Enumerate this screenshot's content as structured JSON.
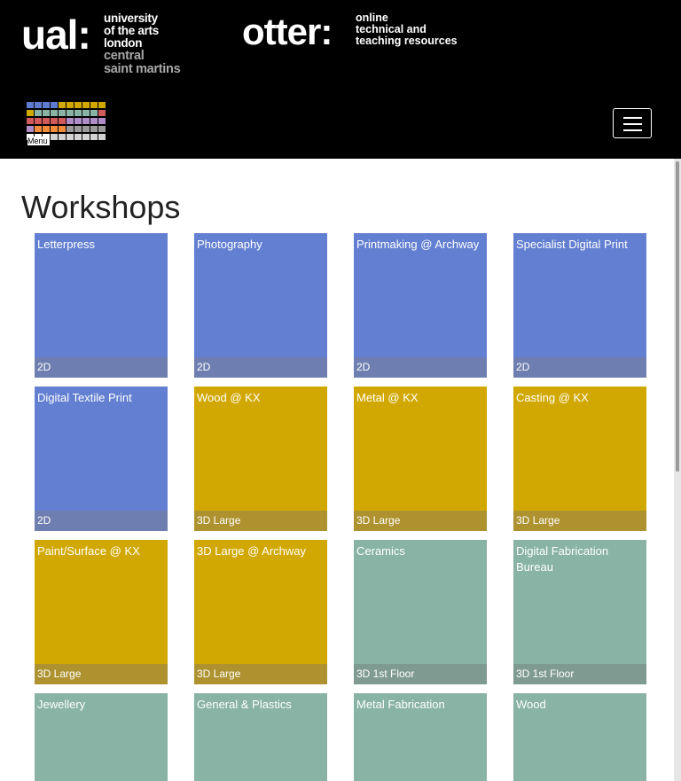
{
  "header": {
    "ual": {
      "mark": "ual:",
      "lines_white": [
        "university",
        "of the arts",
        "london"
      ],
      "lines_grey": [
        "central",
        "saint martins"
      ]
    },
    "otter": {
      "wordmark": "otter:",
      "tagline": [
        "online",
        "technical and",
        "teaching resources"
      ]
    },
    "menu_label": "Menu",
    "menu_icon_name": "hamburger-menu-icon",
    "menu_grid_colors": [
      [
        "#5f7bd0",
        "#5f7bd0",
        "#5f7bd0",
        "#5f7bd0",
        "#d1a800",
        "#d1a800",
        "#d1a800",
        "#d1a800",
        "#d1a800",
        "#d1a800"
      ],
      [
        "#d1a800",
        "#88b3a5",
        "#88b3a5",
        "#88b3a5",
        "#88b3a5",
        "#88b3a5",
        "#88b3a5",
        "#88b3a5",
        "#88b3a5",
        "#d25a5a"
      ],
      [
        "#d25a5a",
        "#d25a5a",
        "#d25a5a",
        "#d25a5a",
        "#d25a5a",
        "#b08cc8",
        "#b08cc8",
        "#b08cc8",
        "#b08cc8",
        "#b08cc8"
      ],
      [
        "#b08cc8",
        "#f08a3c",
        "#f08a3c",
        "#f08a3c",
        "#f08a3c",
        "#9a9a9a",
        "#9a9a9a",
        "#9a9a9a",
        "#9a9a9a",
        "#9a9a9a"
      ],
      [
        "#ffffff",
        "#ffffff",
        "#ffffff",
        "#d3d3d3",
        "#d3d3d3",
        "#d3d3d3",
        "#d3d3d3",
        "#d3d3d3",
        "#d3d3d3",
        "#d3d3d3"
      ]
    ]
  },
  "page_title": "Workshops",
  "colors": {
    "blue": "#627fd1",
    "blue_cat": "#6e7eb0",
    "gold": "#d1a801",
    "gold_cat": "#ae9230",
    "teal": "#88b3a5",
    "teal_cat": "#7f9b91"
  },
  "workshops": [
    {
      "name": "Letterpress",
      "category": "2D",
      "color": "blue"
    },
    {
      "name": "Photography",
      "category": "2D",
      "color": "blue"
    },
    {
      "name": "Printmaking @ Archway",
      "category": "2D",
      "color": "blue"
    },
    {
      "name": "Specialist Digital Print",
      "category": "2D",
      "color": "blue"
    },
    {
      "name": "Digital Textile Print",
      "category": "2D",
      "color": "blue"
    },
    {
      "name": "Wood @ KX",
      "category": "3D Large",
      "color": "gold"
    },
    {
      "name": "Metal @ KX",
      "category": "3D Large",
      "color": "gold"
    },
    {
      "name": "Casting @ KX",
      "category": "3D Large",
      "color": "gold"
    },
    {
      "name": "Paint/Surface @ KX",
      "category": "3D Large",
      "color": "gold"
    },
    {
      "name": "3D Large @ Archway",
      "category": "3D Large",
      "color": "gold"
    },
    {
      "name": "Ceramics",
      "category": "3D 1st Floor",
      "color": "teal"
    },
    {
      "name": "Digital Fabrication Bureau",
      "category": "3D 1st Floor",
      "color": "teal"
    },
    {
      "name": "Jewellery",
      "category": "",
      "color": "teal"
    },
    {
      "name": "General & Plastics",
      "category": "",
      "color": "teal"
    },
    {
      "name": "Metal Fabrication",
      "category": "",
      "color": "teal"
    },
    {
      "name": "Wood",
      "category": "",
      "color": "teal"
    }
  ]
}
